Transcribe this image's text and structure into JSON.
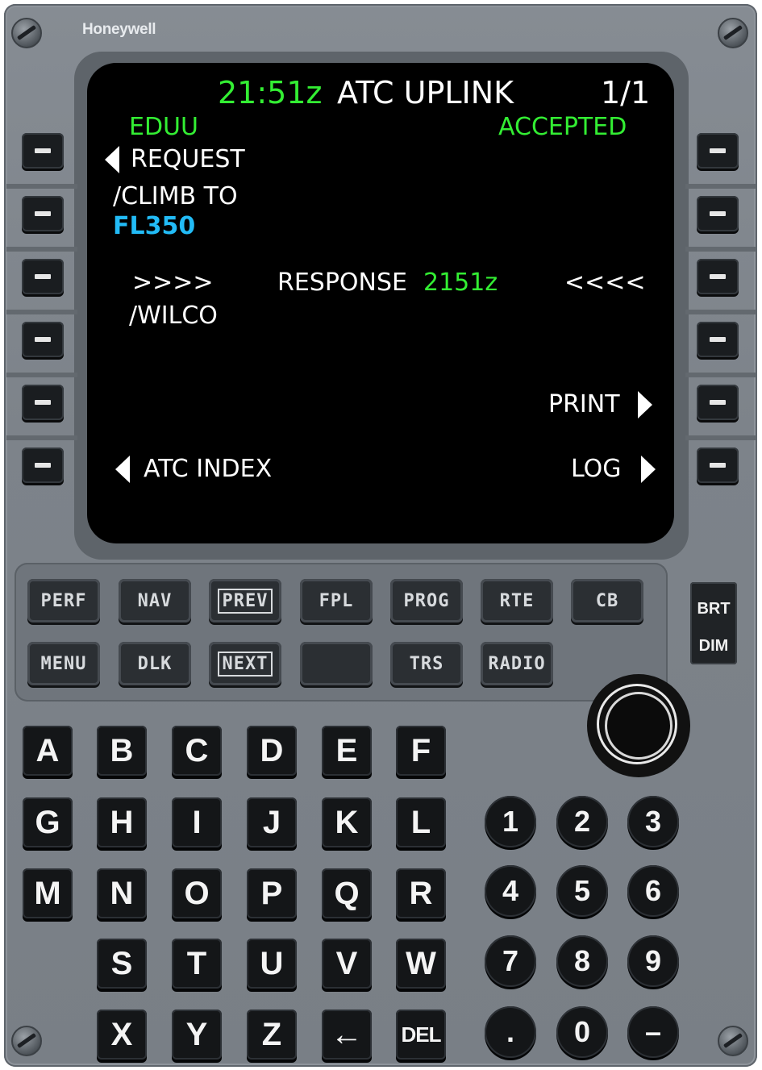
{
  "brand": "Honeywell",
  "screen": {
    "time": "21:51z",
    "title": "ATC UPLINK",
    "page": "1/1",
    "station": "EDUU",
    "status": "ACCEPTED",
    "request_label": "REQUEST",
    "instruction": "/CLIMB TO",
    "flight_level": "FL350",
    "response_left_marker": ">>>>",
    "response_label": "RESPONSE",
    "response_time": "2151z",
    "response_right_marker": "<<<<",
    "response_value": "/WILCO",
    "print_label": "PRINT",
    "atc_index_label": "ATC INDEX",
    "log_label": "LOG"
  },
  "function_keys": {
    "row1": [
      "PERF",
      "NAV",
      "PREV",
      "FPL",
      "PROG",
      "RTE",
      "CB"
    ],
    "row2": [
      "MENU",
      "DLK",
      "NEXT",
      "",
      "TRS",
      "RADIO"
    ]
  },
  "brightness": {
    "brt": "BRT",
    "dim": "DIM"
  },
  "alpha_keys": [
    [
      "A",
      "B",
      "C",
      "D",
      "E",
      "F"
    ],
    [
      "G",
      "H",
      "I",
      "J",
      "K",
      "L"
    ],
    [
      "M",
      "N",
      "O",
      "P",
      "Q",
      "R"
    ],
    [
      "S",
      "T",
      "U",
      "V",
      "W"
    ],
    [
      "X",
      "Y",
      "Z",
      "←",
      "DEL"
    ]
  ],
  "numeric_keys": [
    [
      "1",
      "2",
      "3"
    ],
    [
      "4",
      "5",
      "6"
    ],
    [
      "7",
      "8",
      "9"
    ],
    [
      ".",
      "0",
      "–"
    ]
  ],
  "colors": {
    "screen_green": "#33ee33",
    "screen_cyan": "#22bbf6",
    "screen_white": "#ffffff",
    "panel_gray": "#7d838a"
  }
}
